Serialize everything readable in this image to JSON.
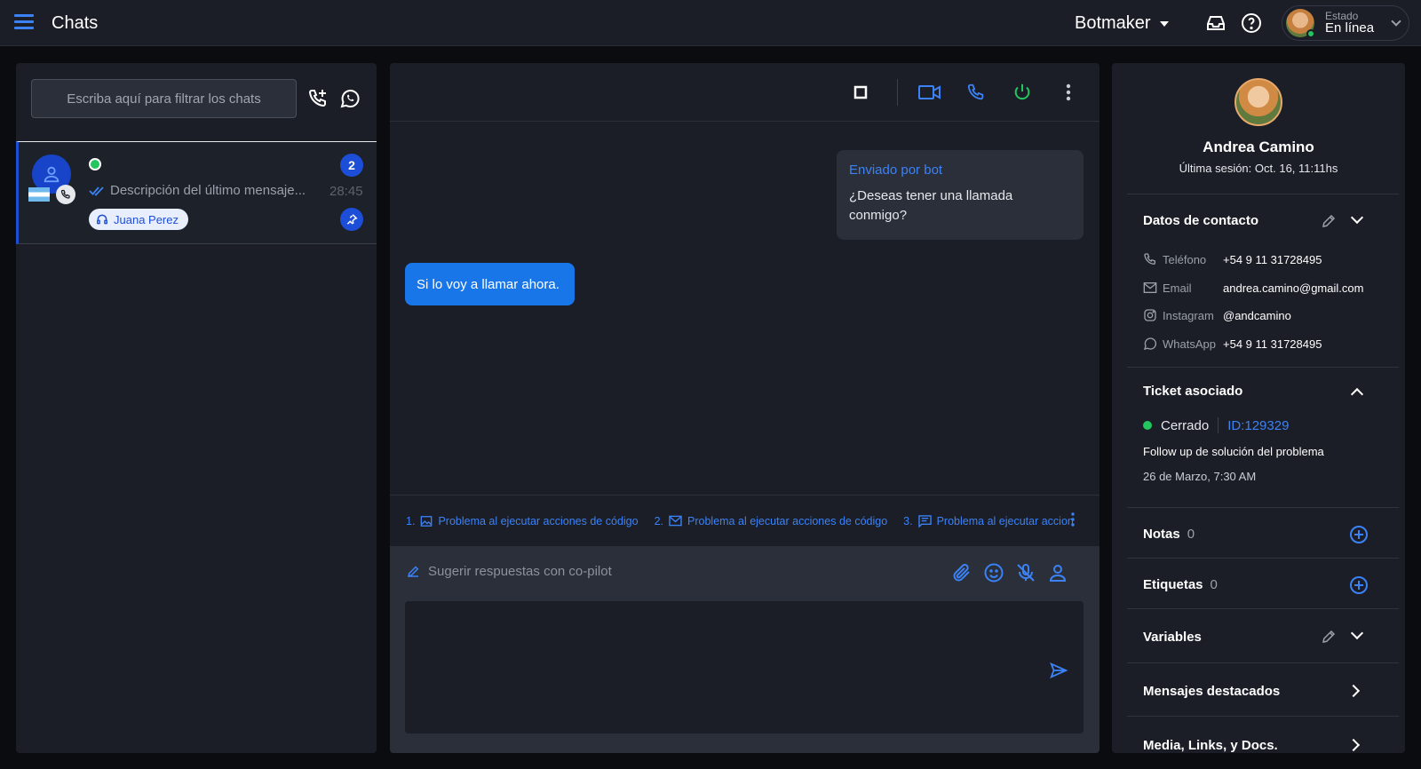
{
  "topbar": {
    "title": "Chats",
    "workspace": "Botmaker",
    "status_label": "Estado",
    "status_value": "En línea"
  },
  "left": {
    "filter_placeholder": "Escriba aquí para filtrar los chats",
    "chat": {
      "unread": "2",
      "last_message": "Descripción del último mensaje...",
      "time": "28:45",
      "agent": "Juana Perez"
    }
  },
  "center": {
    "bot_bubble": {
      "sender": "Enviado por bot",
      "text": "¿Deseas tener una llamada conmigo?"
    },
    "user_bubble": "Si lo voy a llamar ahora.",
    "suggestions": [
      {
        "num": "1.",
        "icon": "image-icon",
        "text": "Problema al ejecutar acciones de código"
      },
      {
        "num": "2.",
        "icon": "mail-icon",
        "text": "Problema al ejecutar acciones de código"
      },
      {
        "num": "3.",
        "icon": "message-icon",
        "text": "Problema al ejecutar accion"
      }
    ],
    "copilot": "Sugerir respuestas con co-pilot"
  },
  "right": {
    "name": "Andrea Camino",
    "session": "Última sesión: Oct. 16, 11:11hs",
    "contact": {
      "title": "Datos de contacto",
      "rows": [
        {
          "label": "Teléfono",
          "value": "+54 9 11 31728495"
        },
        {
          "label": "Email",
          "value": "andrea.camino@gmail.com"
        },
        {
          "label": "Instagram",
          "value": "@andcamino"
        },
        {
          "label": "WhatsApp",
          "value": "+54 9 11 31728495"
        }
      ]
    },
    "ticket": {
      "title": "Ticket asociado",
      "status": "Cerrado",
      "id": "ID:129329",
      "description": "Follow up de solución del problema",
      "date": "26 de Marzo, 7:30 AM"
    },
    "notes": {
      "title": "Notas",
      "count": "0"
    },
    "tags": {
      "title": "Etiquetas",
      "count": "0"
    },
    "variables": {
      "title": "Variables"
    },
    "featured": {
      "title": "Mensajes destacados"
    },
    "media": {
      "title": "Media, Links, y Docs."
    }
  },
  "colors": {
    "accent": "#3b82f6",
    "primary": "#1d4ed8",
    "online": "#22c55e",
    "panel": "#1b1e26",
    "background": "#0b0c0f"
  }
}
